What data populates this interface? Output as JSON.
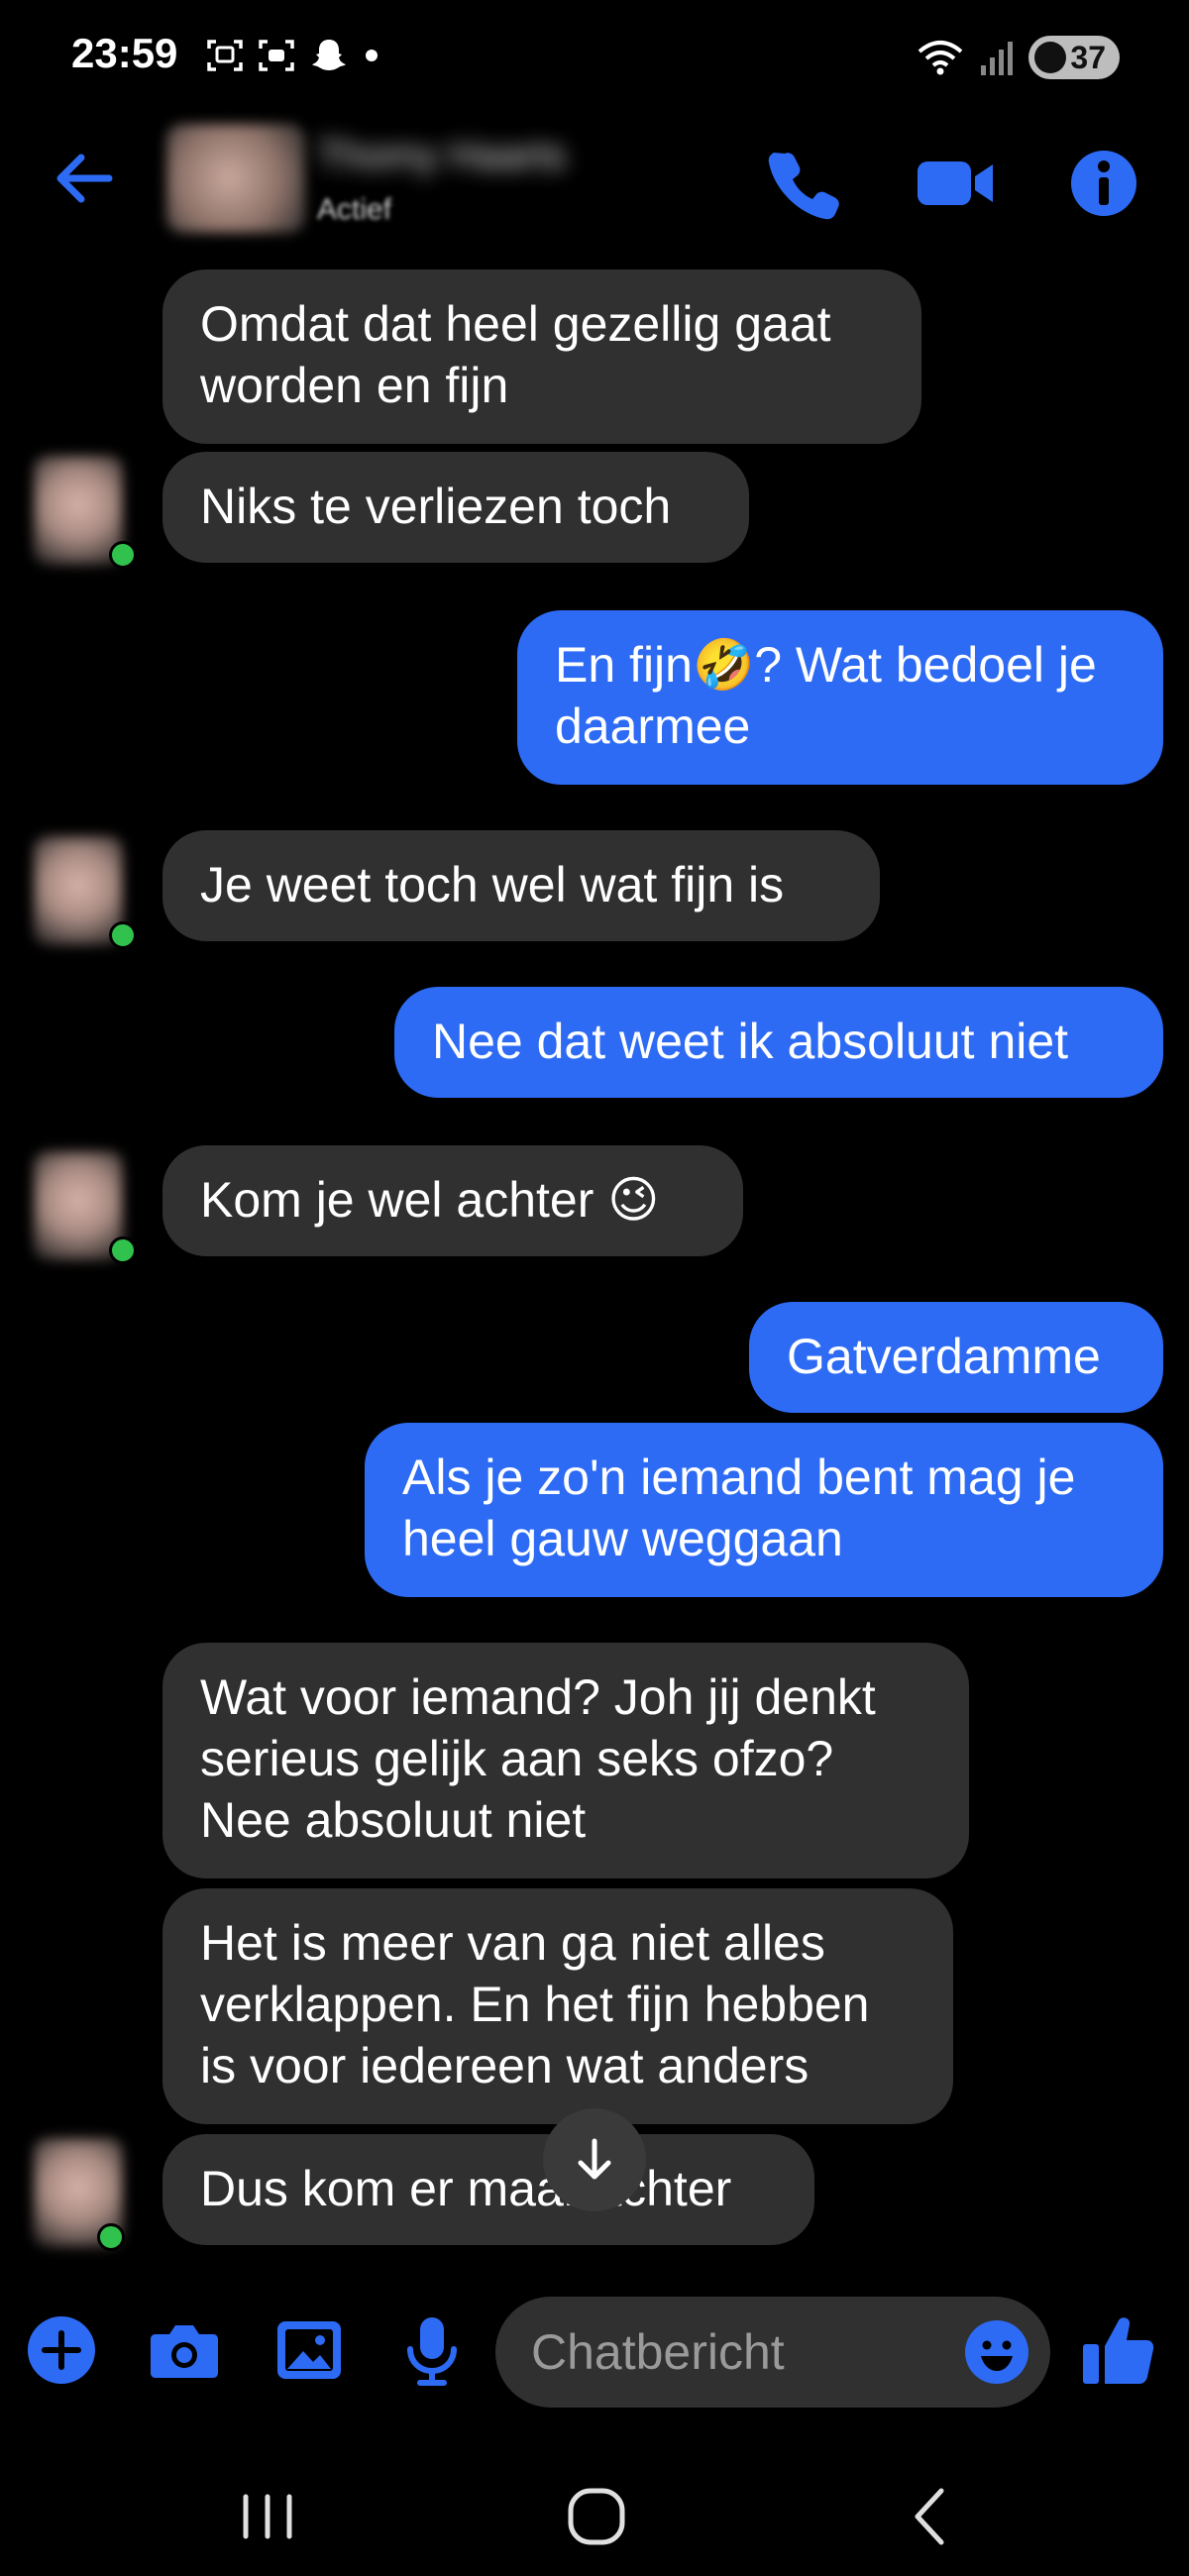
{
  "status_bar": {
    "time": "23:59",
    "battery": "37"
  },
  "header": {
    "contact_name": "Thomy Haarts",
    "contact_status": "Actief"
  },
  "messages": [
    {
      "dir": "in",
      "text": "Omdat dat heel gezellig gaat\nworden en fijn"
    },
    {
      "dir": "in",
      "text": "Niks te verliezen toch"
    },
    {
      "dir": "out",
      "text": "En fijn🤣? Wat bedoel je\ndaarmee"
    },
    {
      "dir": "in",
      "text": "Je weet toch wel wat fijn is"
    },
    {
      "dir": "out",
      "text": "Nee dat weet ik absoluut niet"
    },
    {
      "dir": "in",
      "text": "Kom je wel achter 😉"
    },
    {
      "dir": "out",
      "text": "Gatverdamme"
    },
    {
      "dir": "out",
      "text": "Als je zo'n iemand bent mag je\nheel gauw weggaan"
    },
    {
      "dir": "in",
      "text": "Wat voor iemand? Joh jij denkt\nserieus gelijk aan seks ofzo?\nNee absoluut niet"
    },
    {
      "dir": "in",
      "text": "Het is meer van ga niet alles\nverklappen. En het fijn hebben\nis voor iedereen wat anders"
    },
    {
      "dir": "in",
      "text": "Dus kom er maar achter"
    }
  ],
  "composer": {
    "placeholder": "Chatbericht"
  },
  "colors": {
    "accent": "#2D6BF5",
    "incoming_bubble": "#303030",
    "online": "#31c24d"
  },
  "icons": {
    "status_left": [
      "screenshot-icon",
      "scan-icon",
      "snapchat-icon",
      "dot-icon"
    ],
    "status_right": [
      "wifi-icon",
      "signal-icon",
      "battery-icon"
    ],
    "header": [
      "back-arrow-icon",
      "phone-icon",
      "video-icon",
      "info-icon"
    ],
    "composer": [
      "plus-icon",
      "camera-icon",
      "image-icon",
      "mic-icon",
      "emoji-icon",
      "thumbs-up-icon"
    ],
    "nav": [
      "recents-icon",
      "home-icon",
      "back-icon"
    ]
  }
}
